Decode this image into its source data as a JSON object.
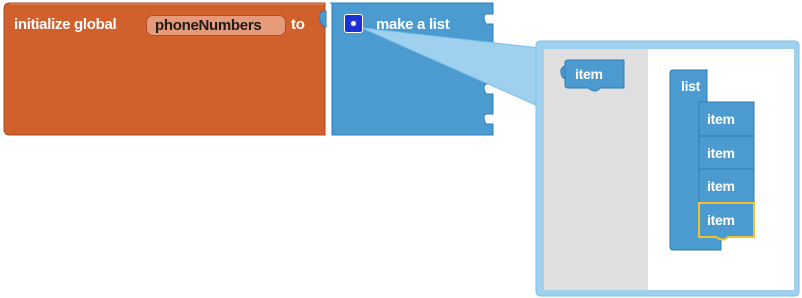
{
  "init_block": {
    "keyword_initialize": "initialize global",
    "variable_name": "phoneNumbers",
    "keyword_to": "to",
    "color": "#d1612c"
  },
  "list_block": {
    "label": "make a list",
    "color": "#4b9bd1",
    "mutator_icon": "gear-icon"
  },
  "mutator": {
    "flyout_item_label": "item",
    "container_label": "list",
    "item_labels": [
      "item",
      "item",
      "item",
      "item"
    ],
    "selected_item_index": 3,
    "highlight_color": "#f2c12e"
  }
}
